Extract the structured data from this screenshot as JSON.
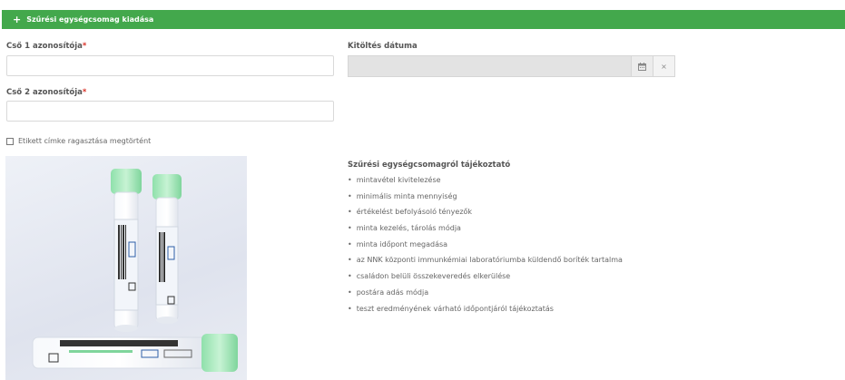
{
  "header": {
    "icon": "plus-icon",
    "plus": "+",
    "title": "Szűrési egységcsomag kiadása",
    "color": "#43a84c"
  },
  "form": {
    "tube1_label": "Cső 1 azonosítója",
    "tube1_value": "",
    "tube2_label": "Cső 2 azonosítója",
    "tube2_value": "",
    "required_mark": "*",
    "date_label": "Kitöltés dátuma",
    "date_value": "",
    "calendar_icon": "calendar-icon",
    "clear_label": "×",
    "checkbox_label": "Etikett címke ragasztása megtörtént"
  },
  "info": {
    "title": "Szűrési egységcsomagról tájékoztató",
    "items": [
      "mintavétel kivitelezése",
      "minimális minta mennyiség",
      "értékelést befolyásoló tényezők",
      "minta kezelés, tárolás módja",
      "minta időpont megadása",
      "az NNK központi immunkémiai laboratóriumba küldendő boríték tartalma",
      "családon belüli összekeveredés elkerülése",
      "postára adás módja",
      "teszt eredményének várható időpontjáról tájékoztatás"
    ]
  }
}
